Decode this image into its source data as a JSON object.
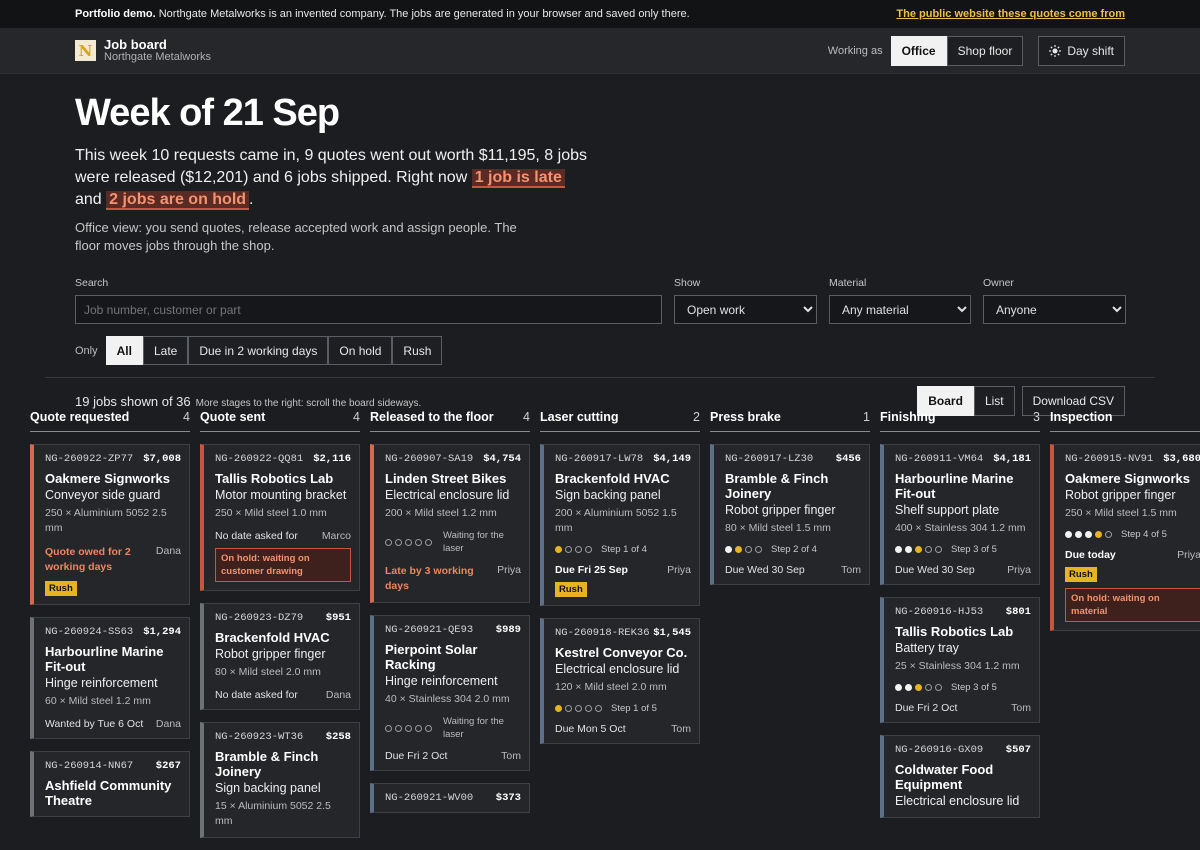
{
  "notice": {
    "bold": "Portfolio demo.",
    "text": "Northgate Metalworks is an invented company. The jobs are generated in your browser and saved only there.",
    "link": "The public website these quotes come from"
  },
  "brand": {
    "logo": "N",
    "title": "Job board",
    "subtitle": "Northgate Metalworks"
  },
  "topbar": {
    "working_as": "Working as",
    "roles": [
      "Office",
      "Shop floor"
    ],
    "active_role": "Office",
    "shift": "Day shift",
    "shift_icon": "sun-icon"
  },
  "hero": {
    "title": "Week of 21 Sep",
    "summary_pre": "This week 10 requests came in, 9 quotes went out worth $11,195, 8 jobs were released ($12,201) and 6 jobs shipped. Right now ",
    "late_alert": "1 job is late",
    "summary_mid": " and ",
    "hold_alert": "2 jobs are on hold",
    "summary_post": ".",
    "view_note": "Office view: you send quotes, release accepted work and assign people. The floor moves jobs through the shop."
  },
  "filters": {
    "search_label": "Search",
    "search_placeholder": "Job number, customer or part",
    "show_label": "Show",
    "show_value": "Open work",
    "material_label": "Material",
    "material_value": "Any material",
    "owner_label": "Owner",
    "owner_value": "Anyone"
  },
  "quick": {
    "label": "Only",
    "options": [
      "All",
      "Late",
      "Due in 2 working days",
      "On hold",
      "Rush"
    ],
    "active": "All"
  },
  "board_head": {
    "count": "19 jobs shown of 36",
    "hint": "More stages to the right: scroll the board sideways.",
    "views": [
      "Board",
      "List"
    ],
    "active_view": "Board",
    "csv": "Download CSV"
  },
  "columns": [
    {
      "title": "Quote requested",
      "count": "4",
      "cards": [
        {
          "id": "NG-260922-ZP77",
          "value": "$7,008",
          "customer": "Oakmere Signworks",
          "part": "Conveyor side guard",
          "spec": "250 × Aluminium 5052 2.5 mm",
          "style": "late",
          "meta": "Quote owed for 2 working days",
          "meta_style": "warn",
          "owner": "Dana",
          "rush": "Rush"
        },
        {
          "id": "NG-260924-SS63",
          "value": "$1,294",
          "customer": "Harbourline Marine Fit-out",
          "part": "Hinge reinforcement",
          "spec": "60 × Mild steel 1.2 mm",
          "style": "plain",
          "meta": "Wanted by Tue 6 Oct",
          "owner": "Dana"
        },
        {
          "id": "NG-260914-NN67",
          "value": "$267",
          "customer": "Ashfield Community Theatre",
          "part": "",
          "spec": "",
          "style": "plain"
        }
      ]
    },
    {
      "title": "Quote sent",
      "count": "4",
      "cards": [
        {
          "id": "NG-260922-QQ81",
          "value": "$2,116",
          "customer": "Tallis Robotics Lab",
          "part": "Motor mounting bracket",
          "spec": "250 × Mild steel 1.0 mm",
          "style": "hold",
          "meta": "No date asked for",
          "owner": "Marco",
          "hold": "On hold: waiting on customer drawing"
        },
        {
          "id": "NG-260923-DZ79",
          "value": "$951",
          "customer": "Brackenfold HVAC",
          "part": "Robot gripper finger",
          "spec": "80 × Mild steel 2.0 mm",
          "style": "plain",
          "meta": "No date asked for",
          "owner": "Dana"
        },
        {
          "id": "NG-260923-WT36",
          "value": "$258",
          "customer": "Bramble & Finch Joinery",
          "part": "Sign backing panel",
          "spec": "15 × Aluminium 5052 2.5 mm",
          "style": "plain"
        }
      ]
    },
    {
      "title": "Released to the floor",
      "count": "4",
      "cards": [
        {
          "id": "NG-260907-SA19",
          "value": "$4,754",
          "customer": "Linden Street Bikes",
          "part": "Electrical enclosure lid",
          "spec": "200 × Mild steel 1.2 mm",
          "style": "late",
          "waiting": "Waiting for the laser",
          "meta": "Late by 3 working days",
          "meta_style": "warn",
          "owner": "Priya"
        },
        {
          "id": "NG-260921-QE93",
          "value": "$989",
          "customer": "Pierpoint Solar Racking",
          "part": "Hinge reinforcement",
          "spec": "40 × Stainless 304 2.0 mm",
          "style": "slate",
          "waiting": "Waiting for the laser",
          "meta": "Due Fri 2 Oct",
          "owner": "Tom"
        },
        {
          "id": "NG-260921-WV00",
          "value": "$373",
          "customer": "",
          "part": "",
          "spec": "",
          "style": "slate"
        }
      ]
    },
    {
      "title": "Laser cutting",
      "count": "2",
      "cards": [
        {
          "id": "NG-260917-LW78",
          "value": "$4,149",
          "customer": "Brackenfold HVAC",
          "part": "Sign backing panel",
          "spec": "200 × Aluminium 5052 1.5 mm",
          "style": "slate",
          "steps_done": 1,
          "steps_total": 4,
          "step_text": "Step 1 of 4",
          "meta": "Due Fri 25 Sep",
          "meta_style": "bold",
          "owner": "Priya",
          "rush": "Rush"
        },
        {
          "id": "NG-260918-REK36",
          "value": "$1,545",
          "customer": "Kestrel Conveyor Co.",
          "part": "Electrical enclosure lid",
          "spec": "120 × Mild steel 2.0 mm",
          "style": "slate",
          "steps_done": 1,
          "steps_total": 5,
          "step_text": "Step 1 of 5",
          "meta": "Due Mon 5 Oct",
          "owner": "Tom"
        }
      ]
    },
    {
      "title": "Press brake",
      "count": "1",
      "cards": [
        {
          "id": "NG-260917-LZ30",
          "value": "$456",
          "customer": "Bramble & Finch Joinery",
          "part": "Robot gripper finger",
          "spec": "80 × Mild steel 1.5 mm",
          "style": "slate",
          "steps_done": 2,
          "steps_total": 4,
          "step_text": "Step 2 of 4",
          "meta": "Due Wed 30 Sep",
          "owner": "Tom"
        }
      ]
    },
    {
      "title": "Finishing",
      "count": "3",
      "cards": [
        {
          "id": "NG-260911-VM64",
          "value": "$4,181",
          "customer": "Harbourline Marine Fit-out",
          "part": "Shelf support plate",
          "spec": "400 × Stainless 304 1.2 mm",
          "style": "slate",
          "steps_done": 3,
          "steps_total": 5,
          "step_text": "Step 3 of 5",
          "meta": "Due Wed 30 Sep",
          "owner": "Priya"
        },
        {
          "id": "NG-260916-HJ53",
          "value": "$801",
          "customer": "Tallis Robotics Lab",
          "part": "Battery tray",
          "spec": "25 × Stainless 304 1.2 mm",
          "style": "slate",
          "steps_done": 3,
          "steps_total": 5,
          "step_text": "Step 3 of 5",
          "meta": "Due Fri 2 Oct",
          "owner": "Tom"
        },
        {
          "id": "NG-260916-GX09",
          "value": "$507",
          "customer": "Coldwater Food Equipment",
          "part": "Electrical enclosure lid",
          "spec": "",
          "style": "slate"
        }
      ]
    },
    {
      "title": "Inspection",
      "count": "",
      "cards": [
        {
          "id": "NG-260915-NV91",
          "value": "$3,680",
          "customer": "Oakmere Signworks",
          "part": "Robot gripper finger",
          "spec": "250 × Mild steel 1.5 mm",
          "style": "hold",
          "steps_done": 4,
          "steps_total": 5,
          "step_text": "Step 4 of 5",
          "meta": "Due today",
          "meta_style": "bold",
          "owner": "Priya",
          "rush": "Rush",
          "hold": "On hold: waiting on material"
        }
      ]
    }
  ]
}
